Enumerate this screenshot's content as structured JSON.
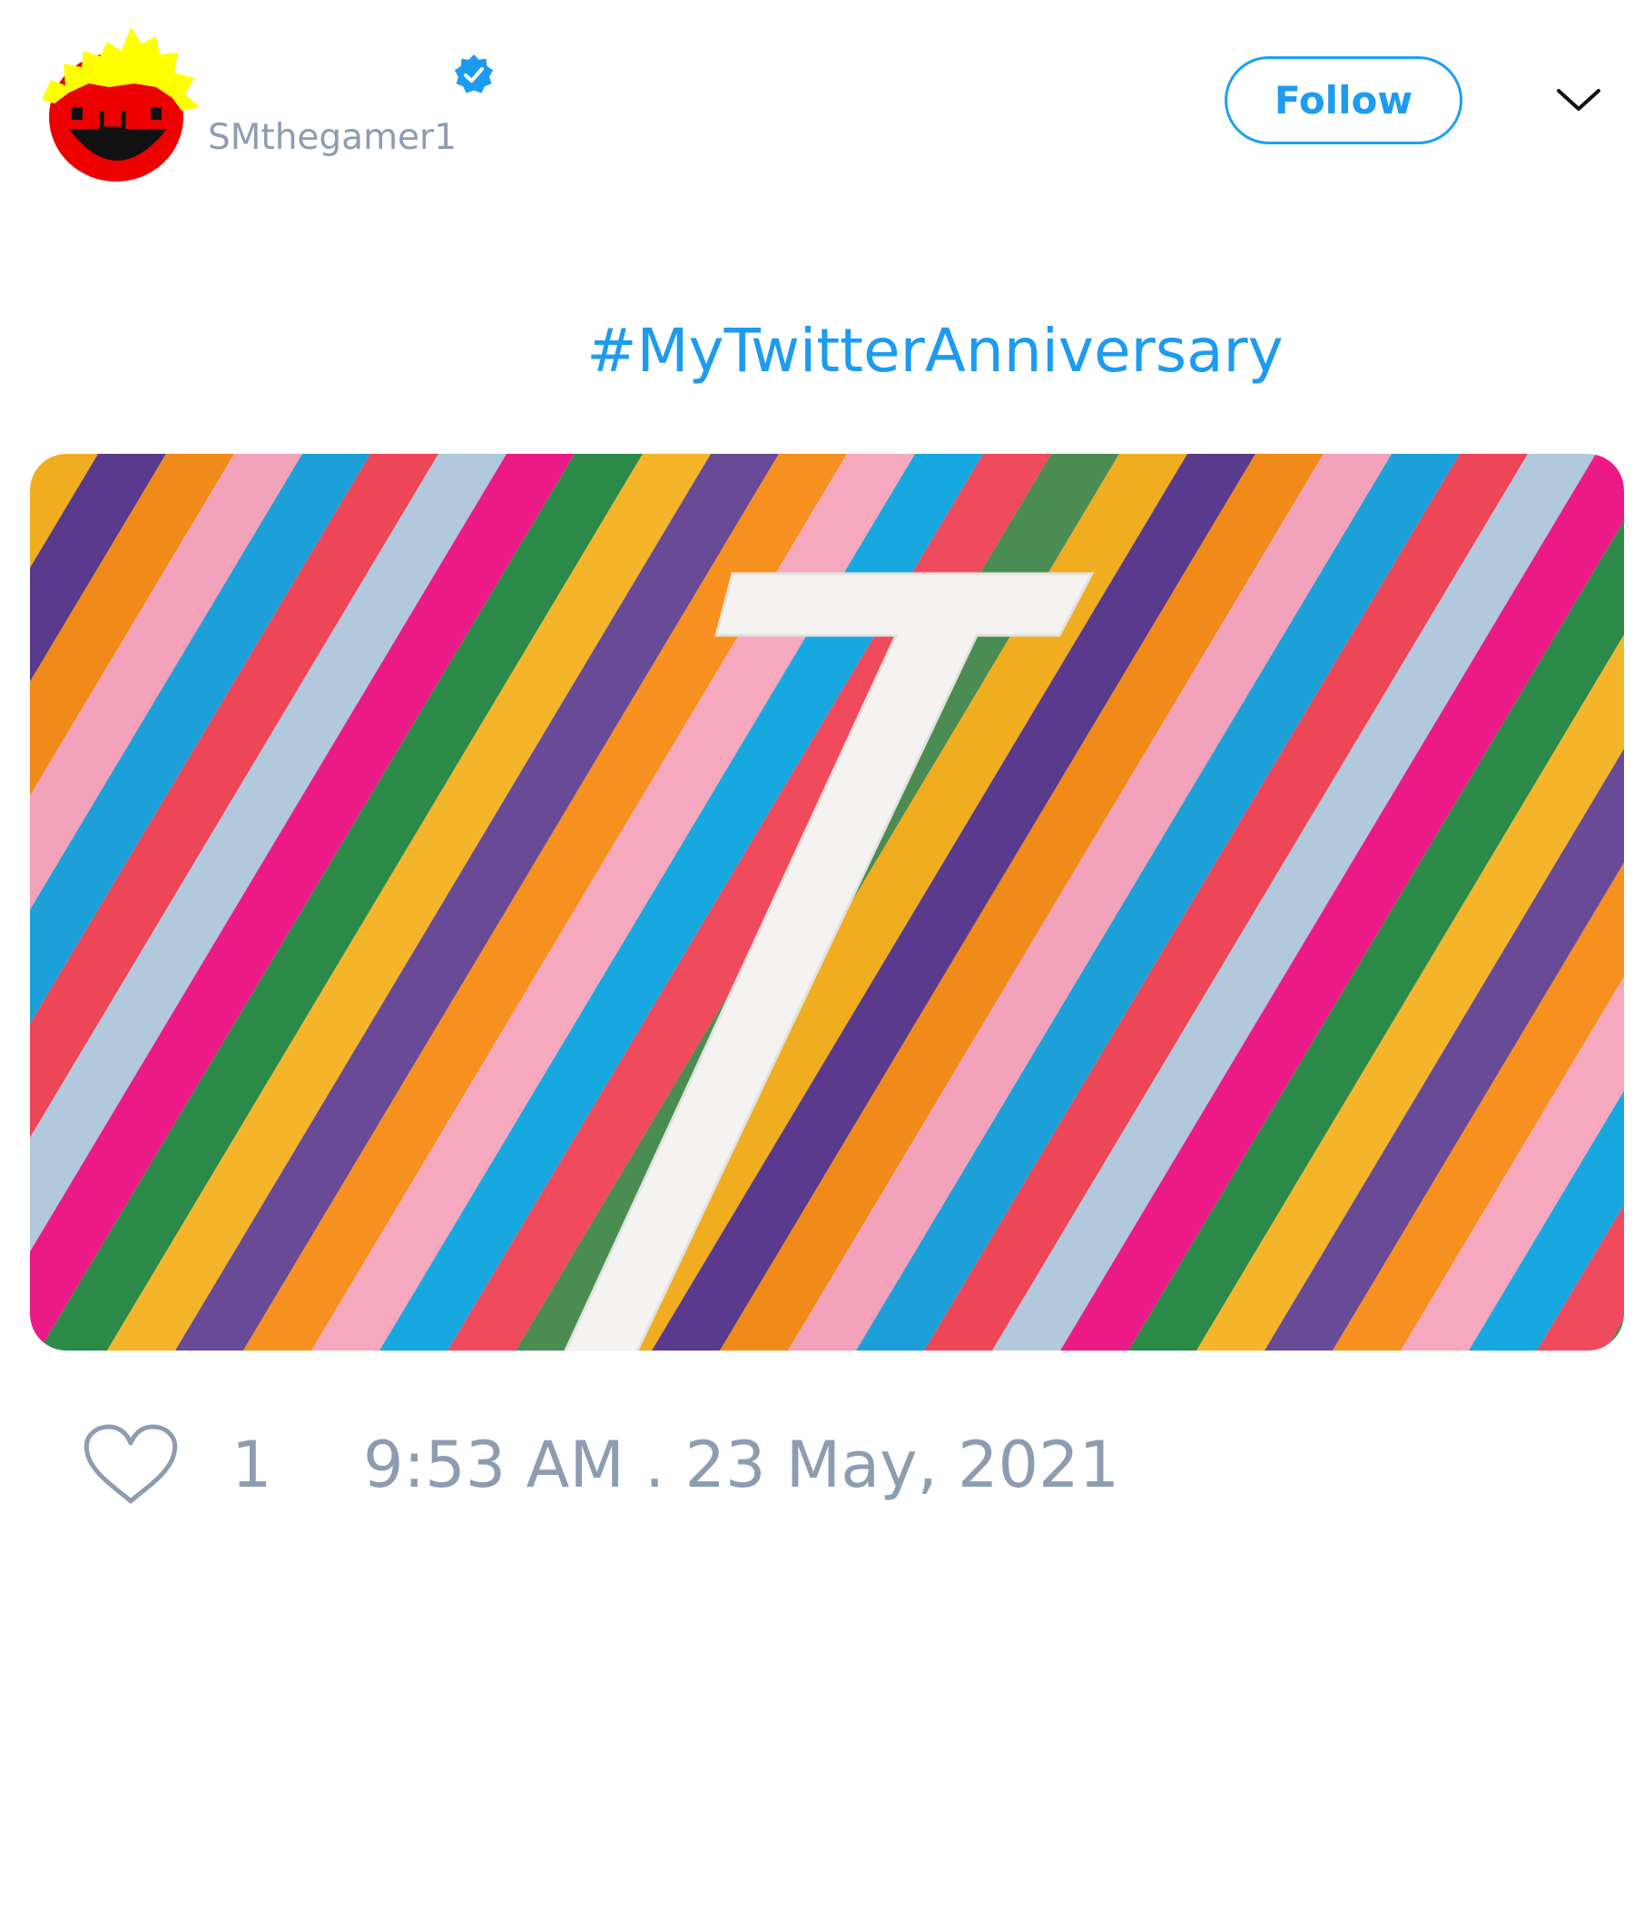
{
  "author": {
    "handle": "SMthegamer1",
    "verified": true
  },
  "actions": {
    "follow_label": "Follow"
  },
  "tweet": {
    "text": "#MyTwitterAnniversary",
    "like_count": "1",
    "timestamp": "9:53 AM . 23 May, 2021"
  },
  "media": {
    "numeral": "7",
    "stripe_colors": [
      "#4b8c52",
      "#f0ad1f",
      "#5a3a8c",
      "#f08a18",
      "#f2a2bb",
      "#1da0d8",
      "#ec4657",
      "#b2c8dc",
      "#ec1a86",
      "#2b8a48",
      "#f5b52a",
      "#694a96",
      "#f6901f",
      "#f6a8be",
      "#18a8e0",
      "#f04a5d"
    ]
  },
  "colors": {
    "accent": "#1d9bf0",
    "muted": "#8d9db1"
  },
  "icons": {
    "avatar": "smiley-face-avatar",
    "verified": "verified-badge-icon",
    "caret": "chevron-down-icon",
    "like": "heart-icon"
  }
}
